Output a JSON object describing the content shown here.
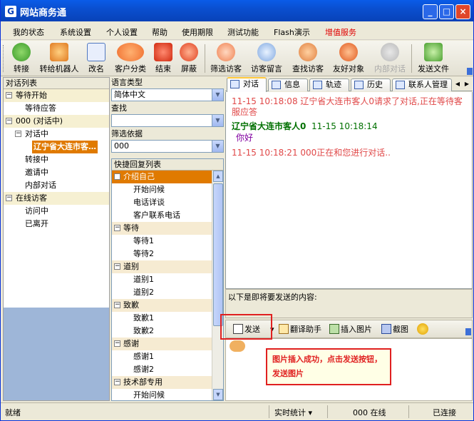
{
  "window": {
    "title": "网站商务通",
    "app_icon_text": "G",
    "minimize": "_",
    "maximize": "□",
    "close": "×"
  },
  "menu": [
    "我的状态",
    "系统设置",
    "个人设置",
    "帮助",
    "使用期限",
    "测试功能",
    "Flash演示",
    "增值服务"
  ],
  "colors": {
    "menu_highlight": "#e00000",
    "system_message": "#e04848",
    "visitor_name": "#007000",
    "visitor_message": "#8000a0",
    "selection": "#e07a00",
    "callout_border": "#e02020"
  },
  "toolbar": [
    {
      "label": "转接",
      "icon": "transfer-icon"
    },
    {
      "label": "转给机器人",
      "icon": "robot-icon"
    },
    {
      "label": "改名",
      "icon": "rename-card-icon"
    },
    {
      "label": "客户分类",
      "icon": "customer-group-icon"
    },
    {
      "label": "结束",
      "icon": "end-chat-icon"
    },
    {
      "label": "屏蔽",
      "icon": "block-icon"
    },
    {
      "label": "筛选访客",
      "icon": "filter-visitor-icon"
    },
    {
      "label": "访客留言",
      "icon": "visitor-message-icon"
    },
    {
      "label": "查找访客",
      "icon": "find-visitor-icon"
    },
    {
      "label": "友好对象",
      "icon": "friend-icon"
    },
    {
      "label": "内部对话",
      "icon": "internal-chat-icon"
    },
    {
      "label": "发送文件",
      "icon": "send-file-icon"
    }
  ],
  "conversation_tree": {
    "header": "对话列表",
    "rows": [
      {
        "label": "等待开始",
        "level": 0,
        "toggle": "⊟"
      },
      {
        "label": "等待应答",
        "level": 2,
        "toggle": ""
      },
      {
        "label": "000 (对话中)",
        "level": 0,
        "toggle": "⊟"
      },
      {
        "label": "对话中",
        "level": 1,
        "toggle": "⊟"
      },
      {
        "label": "辽宁省大连市客…",
        "level": 2,
        "toggle": ""
      },
      {
        "label": "转接中",
        "level": 2,
        "toggle": ""
      },
      {
        "label": "邀请中",
        "level": 2,
        "toggle": ""
      },
      {
        "label": "内部对话",
        "level": 2,
        "toggle": ""
      },
      {
        "label": "在线访客",
        "level": 0,
        "toggle": "⊟"
      },
      {
        "label": "访问中",
        "level": 2,
        "toggle": ""
      },
      {
        "label": "已离开",
        "level": 2,
        "toggle": ""
      }
    ]
  },
  "middle": {
    "language_label": "语言类型",
    "language_value": "简体中文",
    "search_label": "查找",
    "search_value": "",
    "filter_label": "筛选依据",
    "filter_value": "000",
    "quick_reply_header": "快捷回复列表",
    "groups": [
      {
        "name": "介绍自己",
        "items": [
          "开始问候",
          "电话详谈",
          "客户联系电话"
        ]
      },
      {
        "name": "等待",
        "items": [
          "等待1",
          "等待2"
        ]
      },
      {
        "name": "道别",
        "items": [
          "道别1",
          "道别2"
        ]
      },
      {
        "name": "致歉",
        "items": [
          "致歉1",
          "致歉2"
        ]
      },
      {
        "name": "感谢",
        "items": [
          "感谢1",
          "感谢2"
        ]
      },
      {
        "name": "技术部专用",
        "items": [
          "开始问候"
        ]
      }
    ]
  },
  "tabs": [
    "对话",
    "信息",
    "轨迹",
    "历史",
    "联系人管理"
  ],
  "chat": {
    "system_line1": "11-15 10:18:08  辽宁省大连市客人0请求了对话,正在等待客服应答",
    "visitor_name": "辽宁省大连市客人0",
    "visitor_time": "11-15 10:18:14",
    "visitor_text": "你好",
    "system_line2": "11-15 10:18:21  000正在和您进行对话.."
  },
  "send_area": {
    "label": "以下是即将要发送的内容:",
    "send": "发送",
    "translate": "翻译助手",
    "insert_image": "插入图片",
    "screenshot": "截图"
  },
  "callout": "图片插入成功，点击发送按钮，发送图片",
  "status": {
    "left": "就绪",
    "stats": "实时统计",
    "online": "000 在线",
    "connection": "已连接"
  }
}
